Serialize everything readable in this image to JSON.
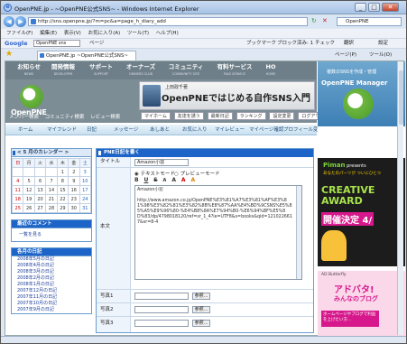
{
  "window": {
    "title": "OpenPNE.jp - ~OpenPNE公式SNS~ - Windows Internet Explorer"
  },
  "address": {
    "url": "http://sns.openpne.jp/?m=pc&a=page_h_diary_add",
    "search": "OpenPNE"
  },
  "menu": [
    "ファイル(F)",
    "編集(E)",
    "表示(V)",
    "お気に入り(A)",
    "ツール(T)",
    "ヘルプ(H)"
  ],
  "google_bar": {
    "label": "Google",
    "query": "OpenPNE sns",
    "items": [
      "ページ",
      "ブックマーク",
      "ブロック済み: 1",
      "チェック",
      "翻訳",
      "設定"
    ]
  },
  "tab": {
    "title": "OpenPNE.jp ~OpenPNE公式SNS~",
    "right_items": [
      "ページ(P)",
      "ツール(O)"
    ]
  },
  "site": {
    "logo": "OpenPNE",
    "top_nav": [
      {
        "label": "お知らせ",
        "sub": "NEWS"
      },
      {
        "label": "開発情報",
        "sub": "DEVELOPER"
      },
      {
        "label": "サポート",
        "sub": "SUPPORT"
      },
      {
        "label": "オーナーズ",
        "sub": "OWNERS CLUB"
      },
      {
        "label": "コミュニティ",
        "sub": "COMMUNITY SITE"
      },
      {
        "label": "有料サービス",
        "sub": "PAID SERVICE"
      },
      {
        "label": "HO",
        "sub": "HOME"
      }
    ],
    "banner": {
      "small": "上田政千著",
      "big": "OpenPNEではじめる自作SNS入門"
    },
    "sub_menu": [
      "メンバー検索",
      "コミュニティ検索",
      "レビュー検索"
    ],
    "header_buttons": [
      "マイホーム",
      "友達を誘う",
      "最新日記",
      "ランキング",
      "設定変更",
      "ログアウト"
    ],
    "global_nav": [
      "ホーム",
      "マイフレンド",
      "日記",
      "メッセージ",
      "あしあと",
      "お気に入り",
      "マイレビュー",
      "マイページ確認",
      "プロフィール変更"
    ]
  },
  "calendar": {
    "title": "< 5 月のカレンダー >",
    "rows": [
      [
        "日",
        "月",
        "火",
        "水",
        "木",
        "金",
        "土"
      ],
      [
        "",
        "",
        "",
        "",
        "1",
        "2",
        "3"
      ],
      [
        "4",
        "5",
        "6",
        "7",
        "8",
        "9",
        "10"
      ],
      [
        "11",
        "12",
        "13",
        "14",
        "15",
        "16",
        "17"
      ],
      [
        "18",
        "19",
        "20",
        "21",
        "22",
        "23",
        "24"
      ],
      [
        "25",
        "26",
        "27",
        "28",
        "29",
        "30",
        "31"
      ]
    ]
  },
  "recent_comments": {
    "title": "最近のコメント",
    "link": "一覧を見る"
  },
  "monthly": {
    "title": "各月の日記",
    "items": [
      "2008年5月の日記",
      "2008年4月の日記",
      "2008年3月の日記",
      "2008年2月の日記",
      "2008年1月の日記",
      "2007年12月の日記",
      "2007年11月の日記",
      "2007年10月の日記",
      "2007年9月の日記"
    ]
  },
  "form": {
    "title": "PNE日記を書く",
    "title_label": "タイトル",
    "title_value": "Amazon小窓",
    "mode_text": "テキストモード",
    "mode_preview": "プレビューモード",
    "toolbar": [
      "B",
      "U",
      "S",
      "A",
      "A",
      "A",
      "A"
    ],
    "body_label": "本文",
    "body_value": "Amazon小窓\n\nhttp://www.amazon.co.jp/OpenPNE%E3%81%A7%E3%81%AF%E3%81%98%E3%82%81%E3%82%8B%E8%87%AA%E4%BD%9CSNS%E5%85%A5%E9%96%80-%E4%B8%8A%E7%94%B0-%E6%94%BF%E5%8D%83/dp/4798018120/ref=sr_1_4?ie=UTF8&s=books&qid=1210226617&sr=8-4",
    "photo_labels": [
      "写真1",
      "写真2",
      "写真3"
    ],
    "browse": "参照..."
  },
  "ads": {
    "manager": {
      "small": "複数のSNSを作成・管理",
      "big": "OpenPNE Manager"
    },
    "award": {
      "pre": "Piman",
      "presents": "presents",
      "sub": "あなたのパーツが ついにひとつ",
      "big": "CREATIVE AWARD",
      "decide": "開催決定 4/"
    },
    "butterfly": {
      "brand": "AD Butterfly",
      "big": "アドバタ!",
      "sub": "みんなのブログ",
      "box": "ホームページやブログで利益を上げたい方…"
    }
  }
}
